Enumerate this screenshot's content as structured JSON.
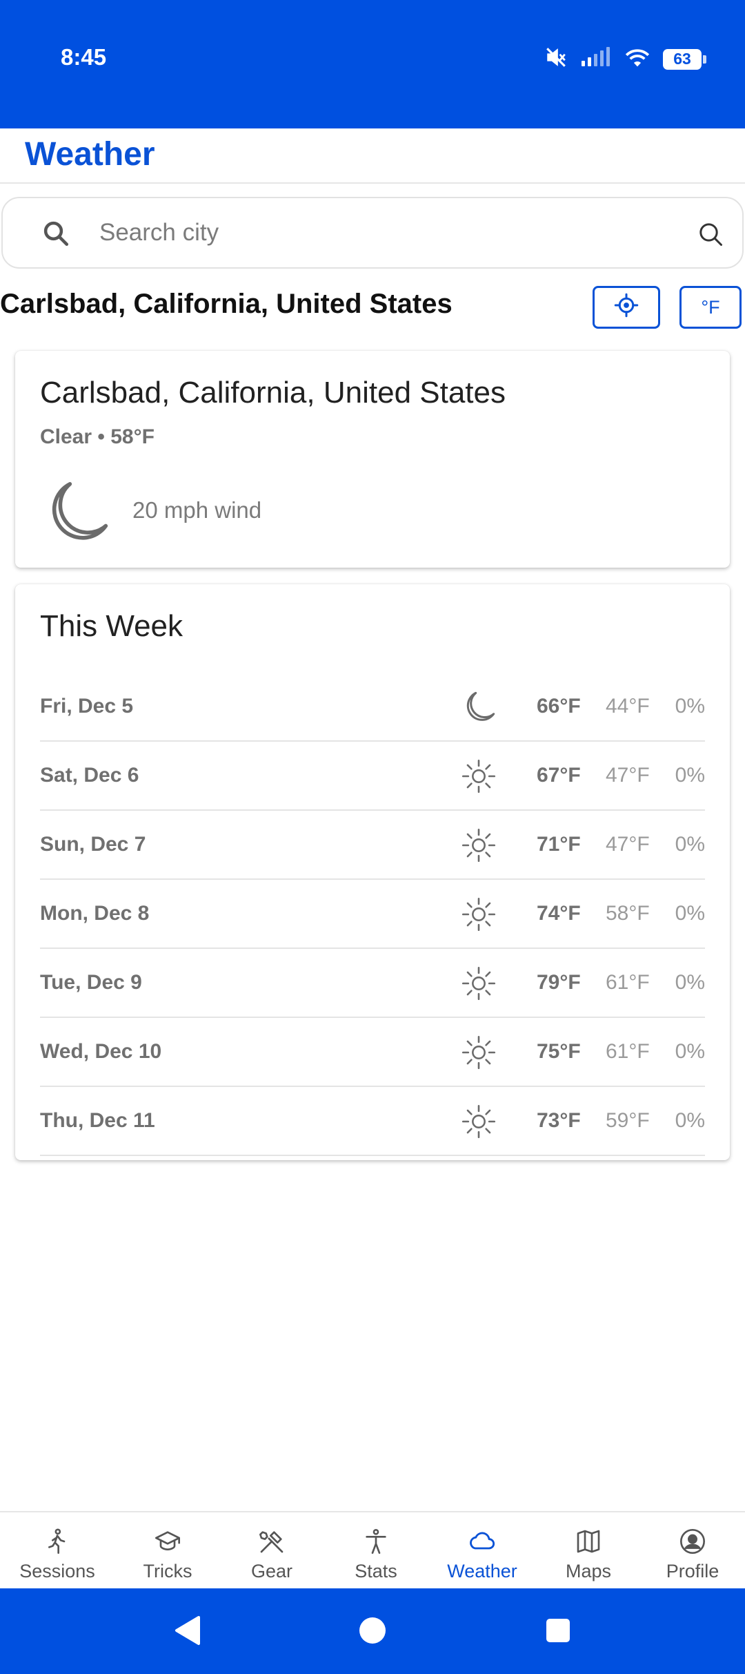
{
  "status_bar": {
    "time": "8:45",
    "battery": "63",
    "icons": [
      "mute-icon",
      "signal-icon",
      "wifi-icon",
      "battery-icon"
    ]
  },
  "header": {
    "title": "Weather"
  },
  "search": {
    "placeholder": "Search city",
    "value": ""
  },
  "location": {
    "title": "Carlsbad, California, United States",
    "unit_button": "°F"
  },
  "current": {
    "city": "Carlsbad, California, United States",
    "summary": "Clear • 58°F",
    "wind": "20 mph wind",
    "icon": "moon-icon"
  },
  "week": {
    "title": "This Week",
    "days": [
      {
        "day": "Fri, Dec 5",
        "icon": "moon-icon",
        "high": "66°F",
        "low": "44°F",
        "precip": "0%"
      },
      {
        "day": "Sat, Dec 6",
        "icon": "sun-icon",
        "high": "67°F",
        "low": "47°F",
        "precip": "0%"
      },
      {
        "day": "Sun, Dec 7",
        "icon": "sun-icon",
        "high": "71°F",
        "low": "47°F",
        "precip": "0%"
      },
      {
        "day": "Mon, Dec 8",
        "icon": "sun-icon",
        "high": "74°F",
        "low": "58°F",
        "precip": "0%"
      },
      {
        "day": "Tue, Dec 9",
        "icon": "sun-icon",
        "high": "79°F",
        "low": "61°F",
        "precip": "0%"
      },
      {
        "day": "Wed, Dec 10",
        "icon": "sun-icon",
        "high": "75°F",
        "low": "61°F",
        "precip": "0%"
      },
      {
        "day": "Thu, Dec 11",
        "icon": "sun-icon",
        "high": "73°F",
        "low": "59°F",
        "precip": "0%"
      }
    ]
  },
  "nav": {
    "active": "Weather",
    "items": [
      {
        "label": "Sessions",
        "icon": "walker-icon"
      },
      {
        "label": "Tricks",
        "icon": "graduation-cap-icon"
      },
      {
        "label": "Gear",
        "icon": "tools-icon"
      },
      {
        "label": "Stats",
        "icon": "person-icon"
      },
      {
        "label": "Weather",
        "icon": "cloud-icon"
      },
      {
        "label": "Maps",
        "icon": "map-icon"
      },
      {
        "label": "Profile",
        "icon": "user-circle-icon"
      }
    ]
  },
  "colors": {
    "primary": "#0050e0",
    "accent_text": "#0a52d6",
    "muted_text": "#707070"
  }
}
